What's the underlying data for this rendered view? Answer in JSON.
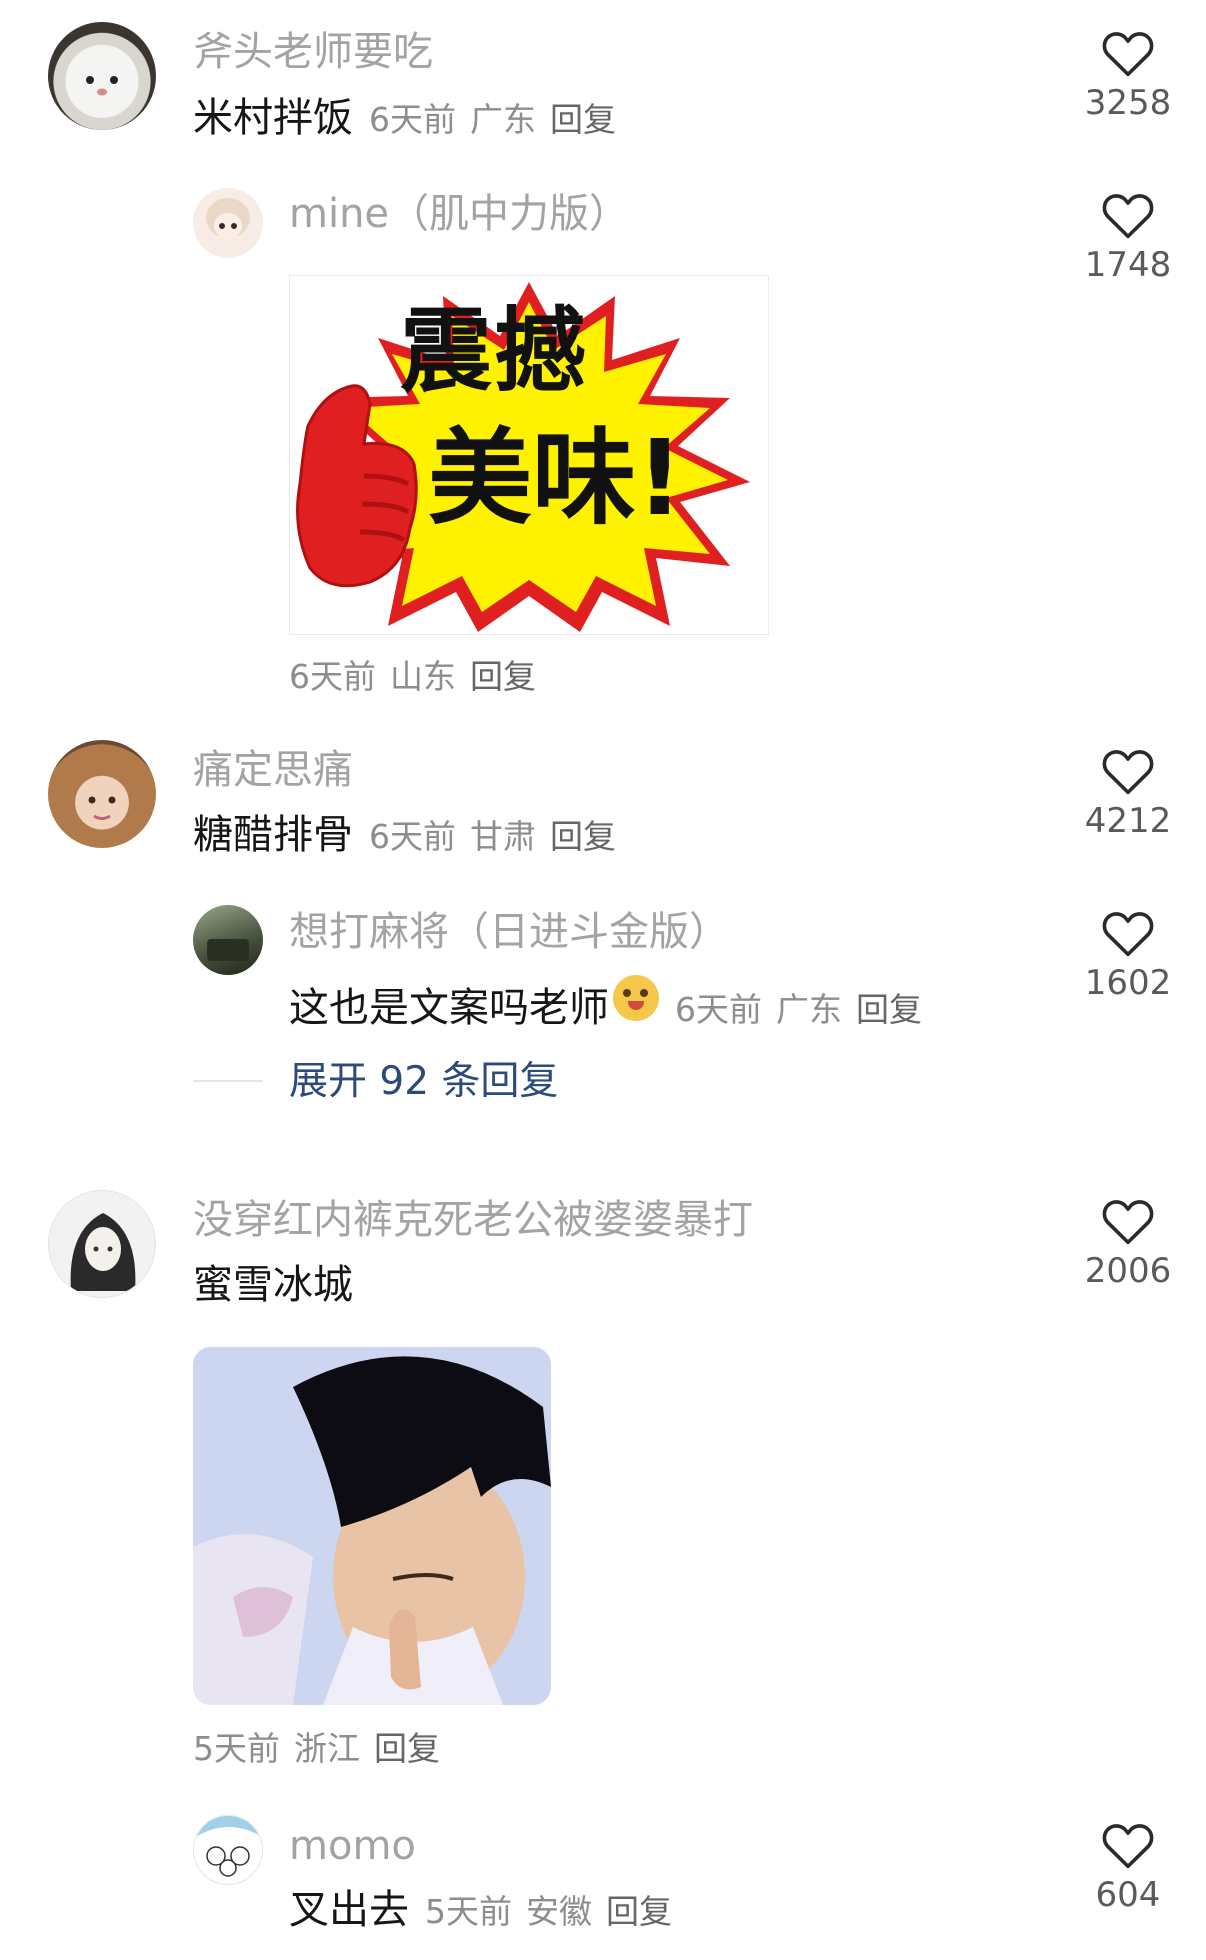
{
  "comments": [
    {
      "user": "斧头老师要吃",
      "content": "米村拌饭",
      "time": "6天前",
      "location": "广东",
      "reply_label": "回复",
      "likes": "3258",
      "replies": [
        {
          "user": "mine（肌中力版）",
          "image_text": [
            "震撼",
            "美味!"
          ],
          "time": "6天前",
          "location": "山东",
          "reply_label": "回复",
          "likes": "1748"
        }
      ]
    },
    {
      "user": "痛定思痛",
      "content": "糖醋排骨",
      "time": "6天前",
      "location": "甘肃",
      "reply_label": "回复",
      "likes": "4212",
      "replies": [
        {
          "user": "想打麻将（日进斗金版）",
          "content": "这也是文案吗老师",
          "time": "6天前",
          "location": "广东",
          "reply_label": "回复",
          "likes": "1602"
        }
      ],
      "expand_label": "展开 92 条回复"
    },
    {
      "user": "没穿红内裤克死老公被婆婆暴打",
      "content": "蜜雪冰城",
      "time": "5天前",
      "location": "浙江",
      "reply_label": "回复",
      "likes": "2006",
      "replies": [
        {
          "user": "momo",
          "content": "叉出去",
          "time": "5天前",
          "location": "安徽",
          "reply_label": "回复",
          "likes": "604"
        }
      ]
    }
  ],
  "icons": {
    "like": "heart-outline-icon",
    "emoji": "smiling-face-emoji-icon"
  },
  "colors": {
    "username": "#a3a3a3",
    "meta": "#8d8d8d",
    "expand": "#2c4a7a",
    "accent_red": "#e02020",
    "accent_yellow": "#fff200"
  }
}
